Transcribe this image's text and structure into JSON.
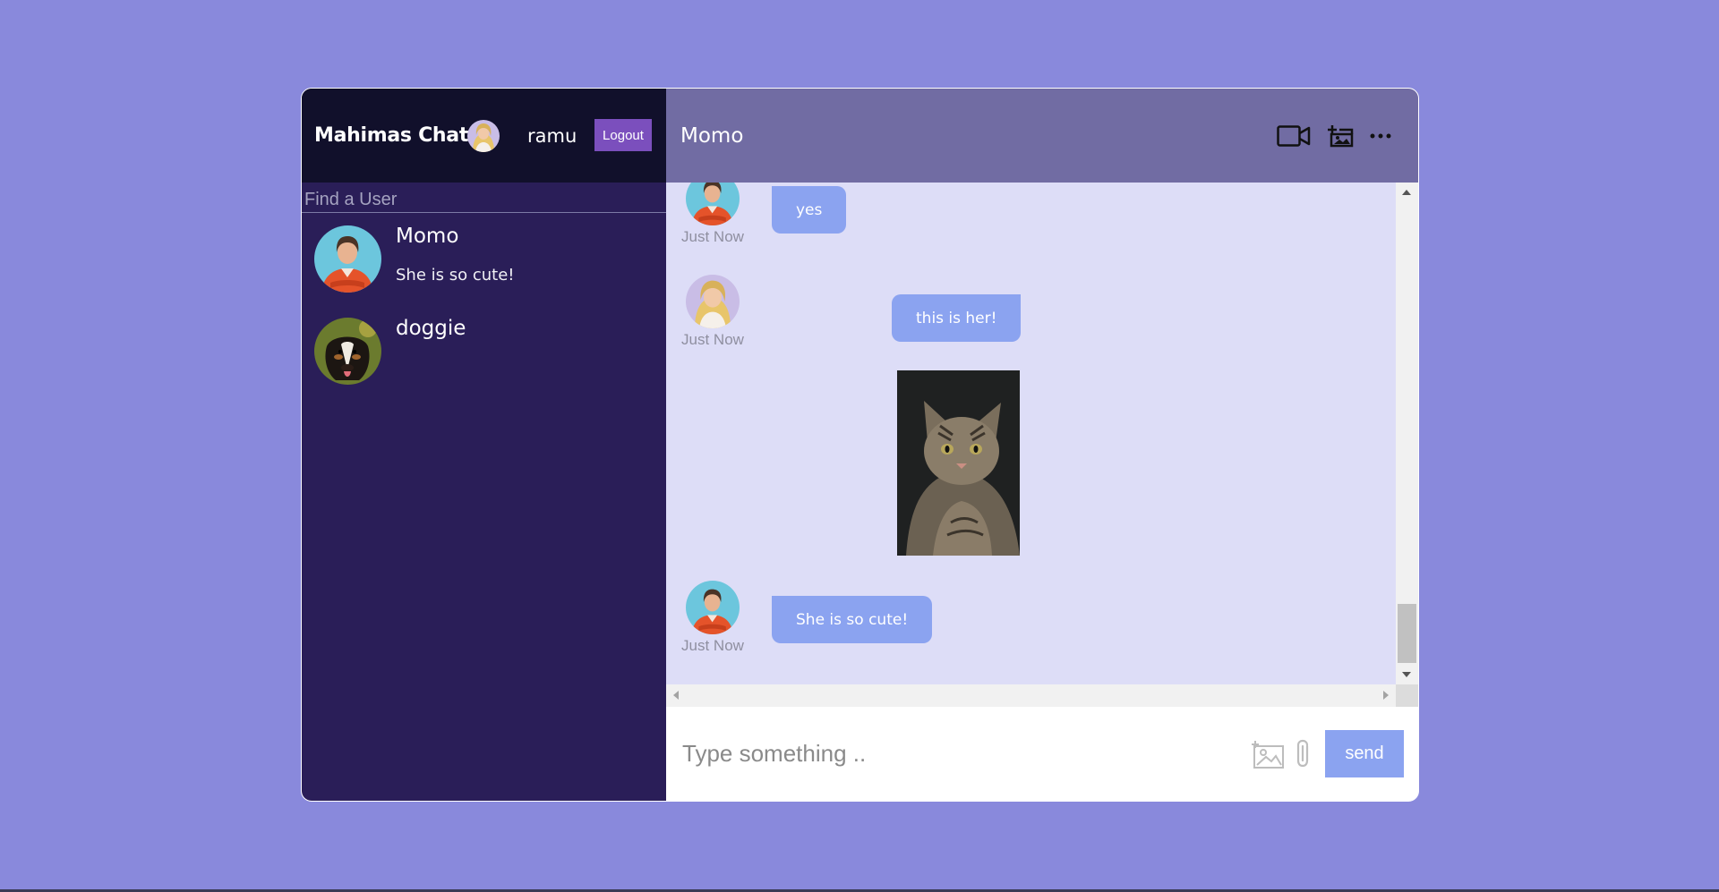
{
  "sidebar": {
    "logo": "Mahimas Chat",
    "current_user": {
      "name": "ramu",
      "avatar": "woman-blonde-avatar"
    },
    "logout_label": "Logout",
    "search_placeholder": "Find a User",
    "chats": [
      {
        "name": "Momo",
        "last_message": "She is so cute!",
        "avatar": "woman-orange-shirt-avatar"
      },
      {
        "name": "doggie",
        "last_message": "",
        "avatar": "dog-avatar"
      }
    ]
  },
  "chat": {
    "title": "Momo",
    "icons": [
      "video-camera-icon",
      "add-friend-icon",
      "more-icon"
    ],
    "messages": [
      {
        "sender": "Momo",
        "owner": false,
        "time": "Just Now",
        "text": "yes"
      },
      {
        "sender": "ramu",
        "owner": true,
        "time": "Just Now",
        "text": "this is her!",
        "image": "cat-photo"
      },
      {
        "sender": "Momo",
        "owner": false,
        "time": "Just Now",
        "text": "She is so cute!"
      }
    ]
  },
  "input": {
    "placeholder": "Type something ..",
    "send_label": "send",
    "icons": [
      "image-upload-icon",
      "attachment-icon"
    ]
  },
  "colors": {
    "background": "#8989dc",
    "sidebar": "#2a1e58",
    "navbar": "#11102b",
    "chat_header": "#716ca3",
    "messages_bg": "#ddddf7",
    "bubble": "#8ba3f0",
    "logout": "#7b4fbd"
  }
}
